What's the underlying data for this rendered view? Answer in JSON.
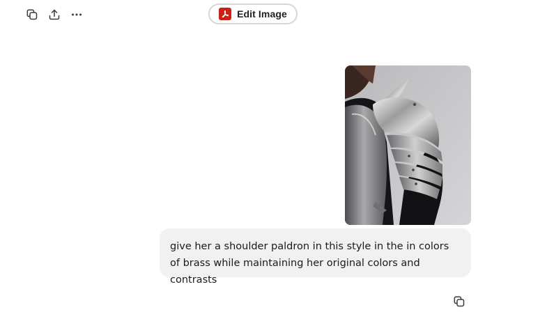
{
  "toolbar": {
    "icons": [
      "copy-icon",
      "share-icon",
      "more-icon"
    ],
    "edit_button_label": "Edit Image",
    "edit_button_icon": "acrobat-pdf-icon",
    "brand_color": "#cc1f16"
  },
  "message": {
    "attachment_icon": "armor-photo",
    "text": "give her a shoulder paldron in this style in the in colors of brass while maintaining her original colors and contrasts",
    "bubble_color": "#f1f1f1"
  },
  "message_actions": {
    "icons": [
      "copy-icon"
    ]
  }
}
